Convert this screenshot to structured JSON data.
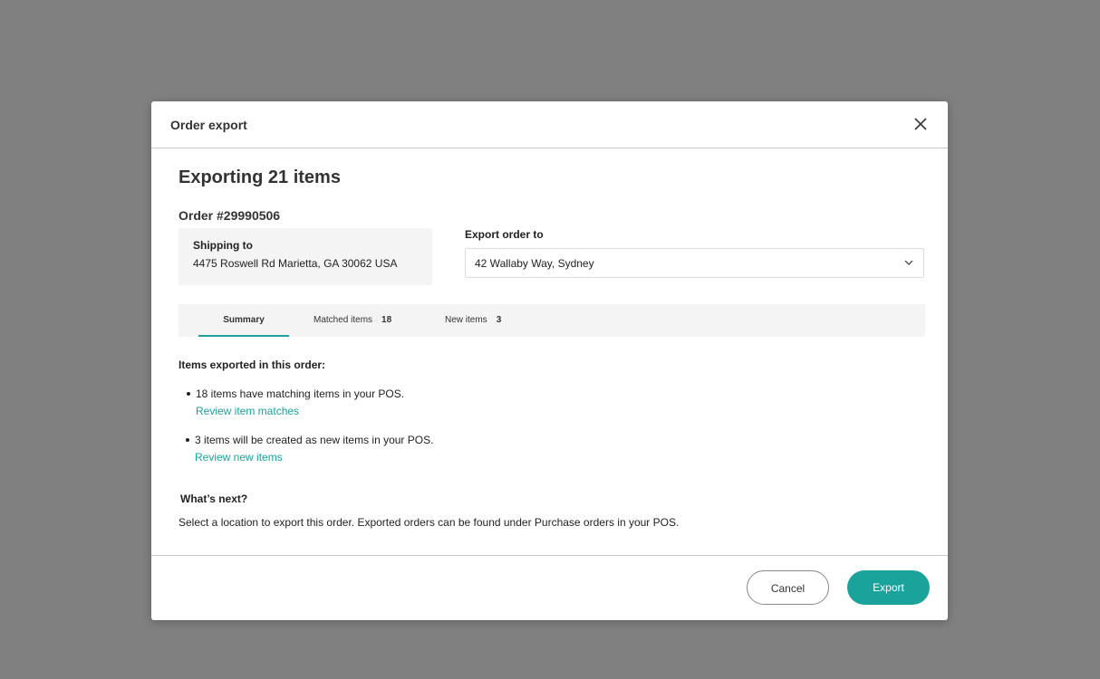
{
  "modal": {
    "title": "Order export",
    "heading": "Exporting 21 items",
    "order_number": "Order #29990506",
    "shipping": {
      "label": "Shipping to",
      "address": "4475 Roswell Rd Marietta, GA 30062 USA"
    },
    "export_to": {
      "label": "Export order to",
      "value": "42 Wallaby Way, Sydney"
    },
    "tabs": [
      {
        "label": "Summary",
        "count": null,
        "active": true
      },
      {
        "label": "Matched items",
        "count": "18",
        "active": false
      },
      {
        "label": "New items",
        "count": "3",
        "active": false
      }
    ],
    "summary": {
      "heading": "Items exported in this order:",
      "bullets": [
        {
          "text": "18 items have matching items in your POS.",
          "link": "Review item matches"
        },
        {
          "text": "3 items will be created as new items in your POS.",
          "link": "Review new items"
        }
      ],
      "next_heading": "What’s next?",
      "next_text": "Select a location to export this order. Exported orders can be found under Purchase orders in your POS."
    },
    "buttons": {
      "cancel": "Cancel",
      "export": "Export"
    }
  },
  "colors": {
    "accent": "#1aa39b",
    "overlay": "#808080"
  },
  "icons": {
    "close": "close-icon",
    "dropdown": "chevron-down-icon"
  }
}
